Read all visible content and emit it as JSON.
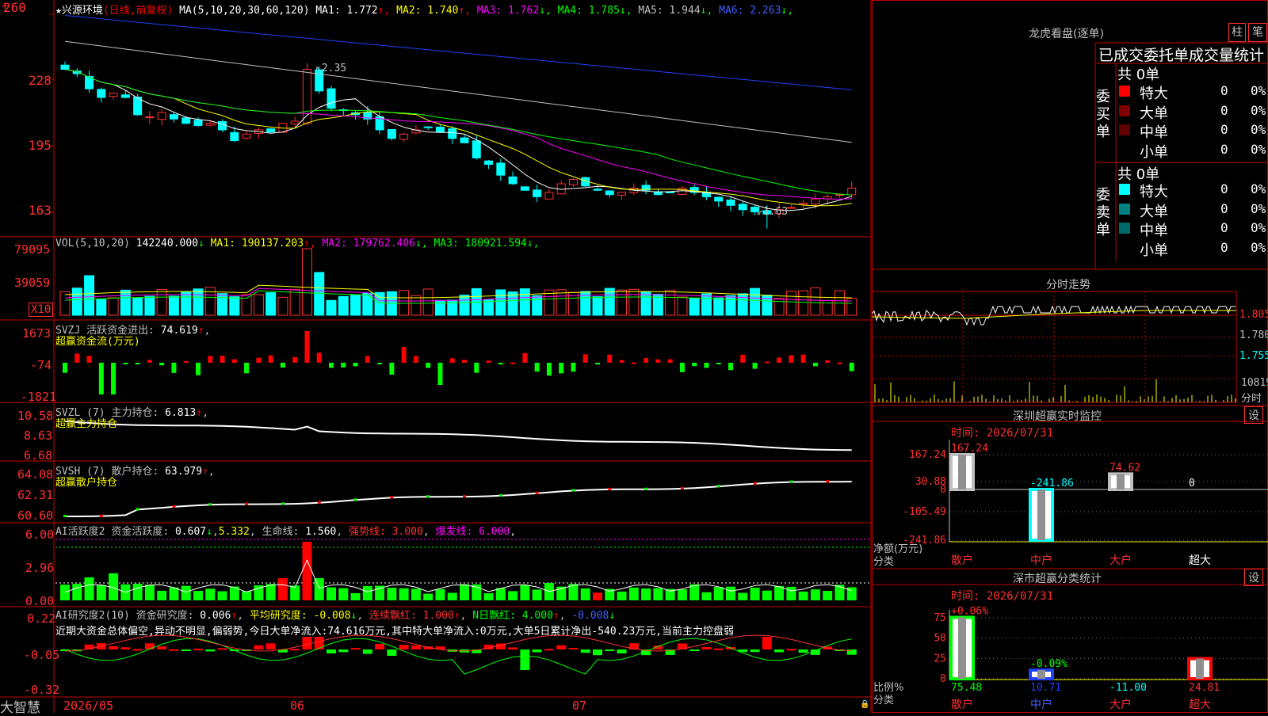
{
  "stock": {
    "star": "★",
    "name": "兴源环境",
    "period": "(日线,前复权)"
  },
  "ma_main": {
    "params": "MA(5,10,20,30,60,120)",
    "items": [
      {
        "label": "MA1: ",
        "value": "1.772",
        "arrow": "↑",
        "color": "#ffffff"
      },
      {
        "label": "MA2: ",
        "value": "1.740",
        "arrow": "↑",
        "color": "#ffff00"
      },
      {
        "label": "MA3: ",
        "value": "1.762",
        "arrow": "↓",
        "color": "#ff00ff"
      },
      {
        "label": "MA4: ",
        "value": "1.785",
        "arrow": "↓",
        "color": "#00ff00"
      },
      {
        "label": "MA5: ",
        "value": "1.944",
        "arrow": "↓",
        "color": "#c0c0c0"
      },
      {
        "label": "MA6: ",
        "value": "2.263",
        "arrow": "↓",
        "color": "#4060ff"
      }
    ],
    "axis": [
      "260",
      "228",
      "195",
      "163"
    ],
    "hi_label": "2.35",
    "lo_label": "1.63"
  },
  "vol": {
    "params": "VOL(5,10,20)",
    "value": "142240.000",
    "value_arrow": "↓",
    "items": [
      {
        "label": "MA1: ",
        "value": "190137.203",
        "arrow": "↑",
        "color": "#ffff00"
      },
      {
        "label": "MA2: ",
        "value": "179762.406",
        "arrow": "↓",
        "color": "#ff00ff"
      },
      {
        "label": "MA3: ",
        "value": "180921.594",
        "arrow": "↓",
        "color": "#00ff00"
      }
    ],
    "axis": [
      "79095",
      "39059"
    ],
    "unit": "X10"
  },
  "svzj": {
    "name": "SVZJ",
    "label": "活跃资金进出: ",
    "value": "74.619",
    "arrow": "↑",
    "sub": "超赢资金流(万元)",
    "axis": [
      "1673",
      "-74",
      "-1821"
    ]
  },
  "svzl": {
    "name": "SVZL",
    "param": "(7)",
    "label": "主力持仓: ",
    "value": "6.813",
    "arrow": "↑",
    "sub": "超赢主力持仓",
    "axis": [
      "10.58",
      "8.63",
      "6.68"
    ]
  },
  "svsh": {
    "name": "SVSH",
    "param": "(7)",
    "label": "散户持仓: ",
    "value": "63.979",
    "arrow": "↑",
    "sub": "超赢散户持仓",
    "axis": [
      "64.08",
      "62.31",
      "60.60"
    ]
  },
  "ai_active": {
    "name": "AI活跃度2",
    "label1": "资金活跃度: ",
    "v1": "0.607",
    "a1": "↓",
    "v2": "5.332",
    "label2": "生命线: ",
    "v3": "1.560",
    "label3": "强势线: ",
    "v4": "3.000",
    "label4": "爆发线: ",
    "v5": "6.000",
    "axis": [
      "6.00",
      "2.96",
      "0.00"
    ]
  },
  "ai_research": {
    "name": "AI研究度2(10)",
    "label1": "资金研究度: ",
    "v1": "0.006",
    "a1": "↑",
    "label2": "平均研究度: ",
    "v2": "-0.008",
    "a2": "↓",
    "label3": "连续飘红: ",
    "v3": "1.000",
    "a3": "↑",
    "label4": "N日飘红: ",
    "v4": "4.000",
    "a4": "↑",
    "v5": "-0.008",
    "a5": "↓",
    "comment": "近期大资金总体偏空,异动不明显,偏弱势,今日大单净流入:74.616万元,其中特大单净流入:0万元,大单5日累计净出-540.23万元,当前主力控盘弱",
    "axis": [
      "0.22",
      "-0.05",
      "-0.32"
    ]
  },
  "bottom": {
    "brand": "大智慧",
    "dates": [
      "2026/05",
      "06",
      "07"
    ]
  },
  "panel_lhb": {
    "title": "龙虎看盘(逐单)",
    "btn1": "柱",
    "btn2": "笔",
    "subtitle": "已成交委托单成交量统计",
    "buy_label": "委买单",
    "sell_label": "委卖单",
    "buy_total": "共 0单",
    "sell_total": "共 0单",
    "buy_rows": [
      {
        "name": "特大",
        "count": "0",
        "pct": "0%",
        "color": "#ff0000"
      },
      {
        "name": "大单",
        "count": "0",
        "pct": "0%",
        "color": "#800000"
      },
      {
        "name": "中单",
        "count": "0",
        "pct": "0%",
        "color": "#600000"
      },
      {
        "name": "小单",
        "count": "0",
        "pct": "0%",
        "color": ""
      }
    ],
    "sell_rows": [
      {
        "name": "特大",
        "count": "0",
        "pct": "0%",
        "color": "#00ffff"
      },
      {
        "name": "大单",
        "count": "0",
        "pct": "0%",
        "color": "#008080"
      },
      {
        "name": "中单",
        "count": "0",
        "pct": "0%",
        "color": "#006a6a"
      },
      {
        "name": "小单",
        "count": "0",
        "pct": "0%",
        "color": ""
      }
    ]
  },
  "panel_fenshi": {
    "title": "分时走势",
    "axis": [
      "1.805",
      "1.780",
      "1.755"
    ],
    "vol_label": "10819",
    "unit": "分时"
  },
  "panel_sz": {
    "title": "深圳超赢实时监控",
    "btn": "设",
    "time_label": "时间: ",
    "date": "2026/07/31",
    "axis": [
      "167.24",
      "30.88",
      "0",
      "-105.49",
      "-241.86"
    ],
    "y_label": "净额(万元)",
    "x_label": "分类",
    "bars": [
      {
        "cat": "散户",
        "value": "167.24",
        "num": 167.24
      },
      {
        "cat": "中户",
        "value": "-241.86",
        "num": -241.86
      },
      {
        "cat": "大户",
        "value": "74.62",
        "num": 74.62
      },
      {
        "cat": "超大",
        "value": "0",
        "num": 0
      }
    ]
  },
  "panel_sh": {
    "title": "深市超赢分类统计",
    "btn": "设",
    "time_label": "时间: ",
    "date": "2026/07/31",
    "axis": [
      "75",
      "50",
      "25",
      "0"
    ],
    "y_label": "比例%",
    "x_label": "分类",
    "bars": [
      {
        "cat": "散户",
        "value": "75.48",
        "top": "+0.06%",
        "num": 75.48
      },
      {
        "cat": "中户",
        "value": "10.71",
        "top": "-0.09%",
        "num": 10.71
      },
      {
        "cat": "大户",
        "value": "-11.00",
        "top": "",
        "num": -11.0
      },
      {
        "cat": "超大",
        "value": "24.81",
        "top": "",
        "num": 24.81
      }
    ]
  },
  "chart_data": [
    {
      "type": "candlestick",
      "categories_span": [
        "2026/05",
        "06",
        "07"
      ],
      "ylim": [
        1.6,
        2.62
      ],
      "close_approx": [
        2.35,
        2.33,
        2.26,
        2.22,
        2.24,
        2.22,
        2.14,
        2.13,
        2.15,
        2.12,
        2.1,
        2.09,
        2.1,
        2.07,
        2.02,
        2.05,
        2.07,
        2.06,
        2.1,
        2.11,
        2.35,
        2.25,
        2.17,
        2.16,
        2.14,
        2.12,
        2.07,
        2.03,
        2.05,
        2.07,
        2.08,
        2.06,
        2.03,
        2.01,
        1.94,
        1.91,
        1.86,
        1.82,
        1.79,
        1.76,
        1.78,
        1.82,
        1.84,
        1.81,
        1.79,
        1.77,
        1.78,
        1.8,
        1.79,
        1.77,
        1.78,
        1.8,
        1.78,
        1.76,
        1.74,
        1.72,
        1.7,
        1.69,
        1.68,
        1.7,
        1.71,
        1.73,
        1.75,
        1.76,
        1.77,
        1.8
      ]
    },
    {
      "type": "bar",
      "name": "VOL",
      "ylim": [
        0,
        79095
      ]
    },
    {
      "type": "bar",
      "name": "SVZJ",
      "ylim": [
        -1821,
        1673
      ]
    },
    {
      "type": "line",
      "name": "SVZL",
      "ylim": [
        6.68,
        10.58
      ]
    },
    {
      "type": "line",
      "name": "SVSH",
      "ylim": [
        60.6,
        64.08
      ]
    },
    {
      "type": "bar",
      "name": "AI活跃度2",
      "ylim": [
        0,
        6.0
      ]
    },
    {
      "type": "bar",
      "name": "AI研究度2",
      "ylim": [
        -0.32,
        0.22
      ]
    }
  ]
}
